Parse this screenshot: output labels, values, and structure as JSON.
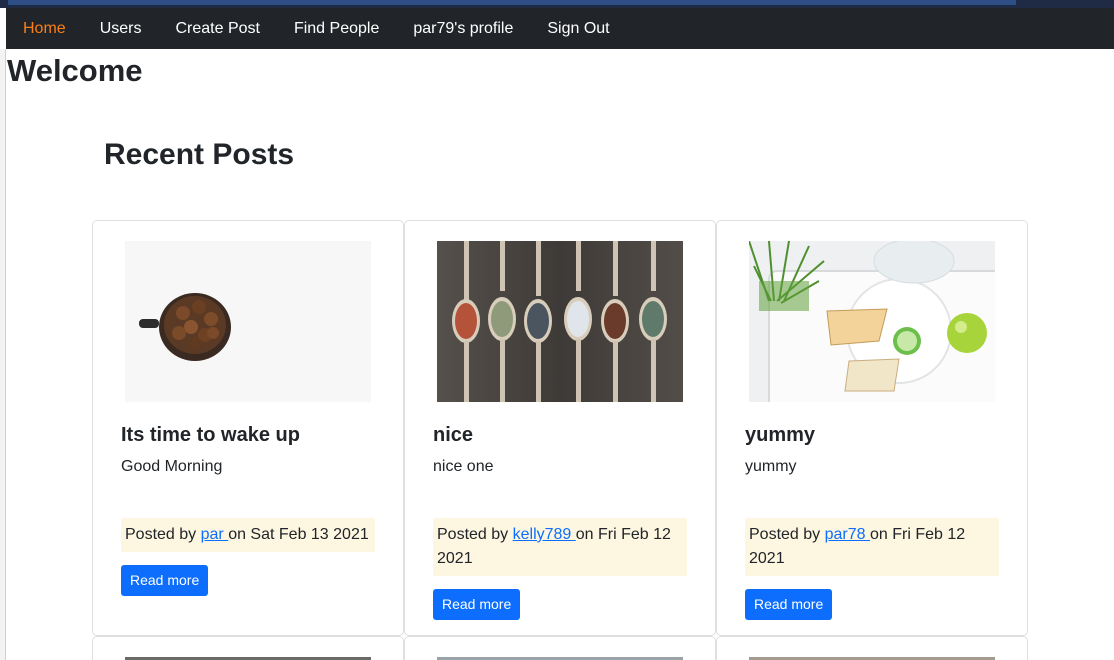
{
  "nav": {
    "items": [
      {
        "label": "Home",
        "active": true
      },
      {
        "label": "Users"
      },
      {
        "label": "Create Post"
      },
      {
        "label": "Find People"
      },
      {
        "label": "par79's profile"
      },
      {
        "label": "Sign Out"
      }
    ]
  },
  "page": {
    "welcome": "Welcome",
    "recent_heading": "Recent Posts"
  },
  "posts": [
    {
      "title": "Its time to wake up",
      "body": "Good Morning",
      "posted_by_prefix": "Posted by ",
      "author": "par ",
      "date_text": "on Sat Feb 13 2021",
      "read_more": "Read more",
      "image": "coffee-cup-image"
    },
    {
      "title": "nice",
      "body": "nice one",
      "posted_by_prefix": "Posted by ",
      "author": "kelly789 ",
      "date_text": "on Fri Feb 12 2021",
      "read_more": "Read more",
      "image": "spice-spoons-image"
    },
    {
      "title": "yummy",
      "body": "yummy",
      "posted_by_prefix": "Posted by ",
      "author": "par78 ",
      "date_text": "on Fri Feb 12 2021",
      "read_more": "Read more",
      "image": "food-plate-image"
    }
  ],
  "colors": {
    "navbar": "#212529",
    "nav_active": "#fd7e14",
    "button": "#0d6efd",
    "posted_bg": "#fdf6e0",
    "link": "#0d6efd"
  }
}
